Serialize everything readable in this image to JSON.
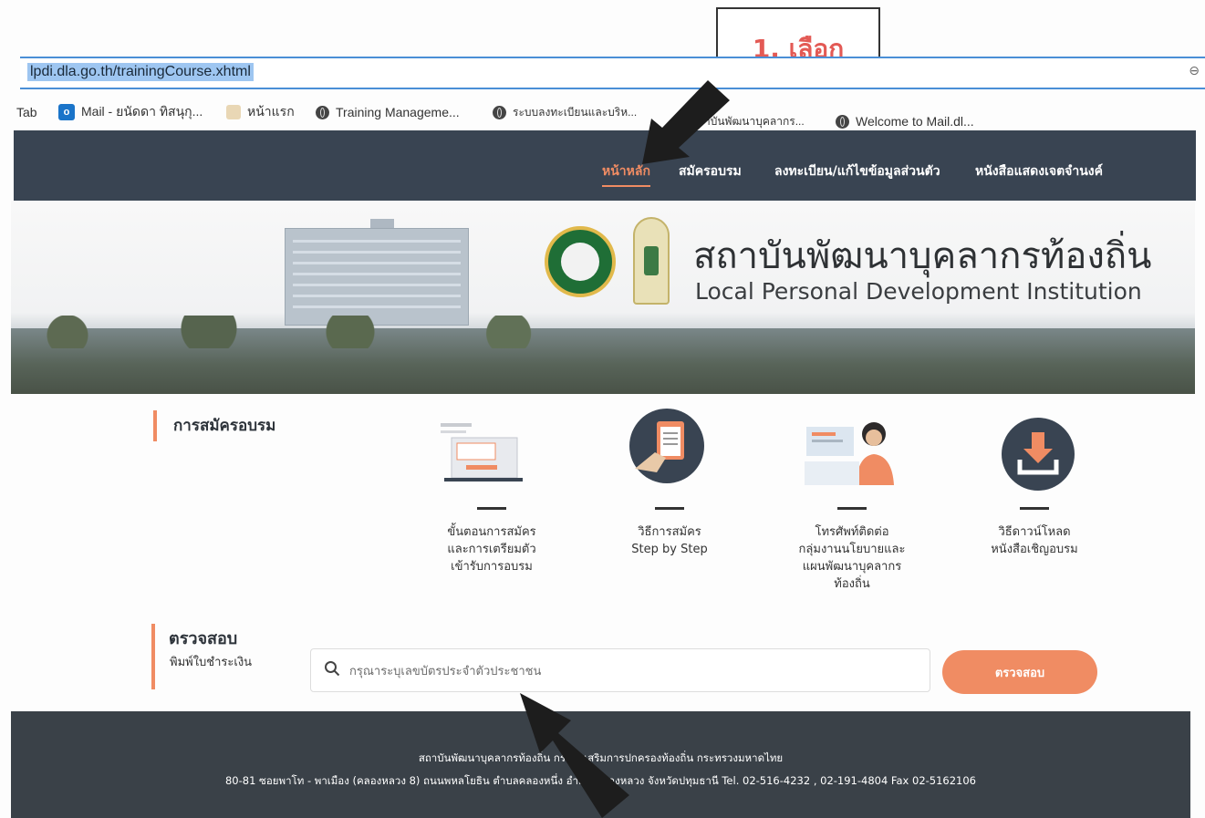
{
  "browser": {
    "url": "lpdi.dla.go.th/trainingCourse.xhtml",
    "url_right_glyph": "⊖"
  },
  "bookmarks": [
    {
      "label": "Tab",
      "icon": "none"
    },
    {
      "label": "Mail - ยนัดดา ทิสนุกุ...",
      "icon": "outlook-icon"
    },
    {
      "label": "หน้าแรก",
      "icon": "person-icon"
    },
    {
      "label": "Training Manageme...",
      "icon": "globe-icon"
    },
    {
      "label": "ระบบลงทะเบียนและบริห...",
      "icon": "globe-icon"
    },
    {
      "label": "าบันพัฒนาบุคลากร...",
      "icon": "none"
    },
    {
      "label": "Welcome to Mail.dl...",
      "icon": "globe-icon"
    }
  ],
  "nav": {
    "items": [
      {
        "label": "หน้าหลัก",
        "active": true
      },
      {
        "label": "สมัครอบรม",
        "active": false
      },
      {
        "label": "ลงทะเบียน/แก้ไขข้อมูลส่วนตัว",
        "active": false
      },
      {
        "label": "หนังสือแสดงเจตจำนงค์",
        "active": false
      }
    ]
  },
  "annotation": {
    "label": "1. เลือก",
    "color": "#e35a55"
  },
  "banner": {
    "title_th": "สถาบันพัฒนาบุคลากรท้องถิ่น",
    "title_en": "Local Personal Development Institution"
  },
  "registration": {
    "title": "การสมัครอบรม",
    "cards": [
      {
        "icon": "laptop-form-icon",
        "text": "ขั้นตอนการสมัคร\nและการเตรียมตัว\nเข้ารับการอบรม"
      },
      {
        "icon": "clipboard-hand-icon",
        "text": "วิธีการสมัคร\nStep by Step"
      },
      {
        "icon": "call-center-icon",
        "text": "โทรศัพท์ติดต่อ\nกลุ่มงานนโยบายและ\nแผนพัฒนาบุคลากร\nท้องถิ่น"
      },
      {
        "icon": "download-icon",
        "text": "วิธีดาวน์โหลด\nหนังสือเชิญอบรม"
      }
    ]
  },
  "check": {
    "title": "ตรวจสอบ",
    "subtitle": "พิมพ์ใบชำระเงิน",
    "placeholder": "กรุณาระบุเลขบัตรประจำตัวประชาชน",
    "button": "ตรวจสอบ"
  },
  "footer": {
    "line1": "สถาบันพัฒนาบุคลากรท้องถิ่น กรมส่งเสริมการปกครองท้องถิ่น กระทรวงมหาดไทย",
    "line2": "80-81 ซอยพาโท - พาเมือง (คลองหลวง 8) ถนนพหลโยธิน ตำบลคลองหนึ่ง อำเภอคลองหลวง จังหวัดปทุมธานี Tel. 02-516-4232 , 02-191-4804 Fax 02-5162106"
  },
  "colors": {
    "accent": "#f08c63",
    "nav_bg": "#394452",
    "footer_bg": "#3a4148",
    "url_border": "#4a8fd6"
  }
}
